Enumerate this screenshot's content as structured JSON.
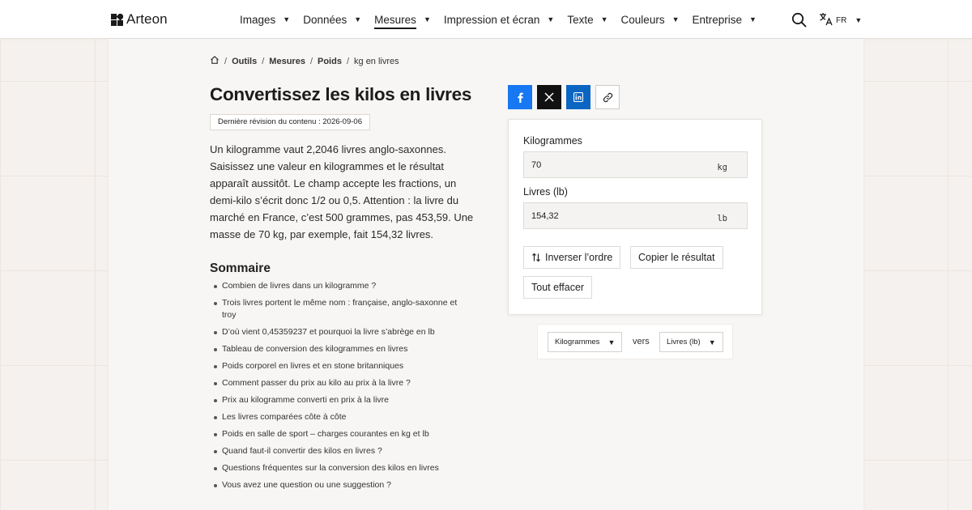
{
  "brand": {
    "name": "Arteon"
  },
  "nav": {
    "items": [
      {
        "label": "Images"
      },
      {
        "label": "Données"
      },
      {
        "label": "Mesures"
      },
      {
        "label": "Impression et écran"
      },
      {
        "label": "Texte"
      },
      {
        "label": "Couleurs"
      },
      {
        "label": "Entreprise"
      }
    ],
    "active": "Mesures",
    "language": "FR"
  },
  "breadcrumb": [
    "Outils",
    "Mesures",
    "Poids",
    "kg en livres"
  ],
  "page": {
    "title": "Convertissez les kilos en livres",
    "revision": "Dernière révision du contenu : 2026-09-06",
    "intro": "Un kilogramme vaut 2,2046 livres anglo-saxonnes. Saisissez une valeur en kilogrammes et le résultat apparaît aussitôt. Le champ accepte les fractions, un demi-kilo s’écrit donc 1/2 ou 0,5. Attention : la livre du marché en France, c’est 500 grammes, pas 453,59. Une masse de 70 kg, par exemple, fait 154,32 livres."
  },
  "toc": {
    "title": "Sommaire",
    "items": [
      "Combien de livres dans un kilogramme ?",
      "Trois livres portent le même nom : française, anglo-saxonne et troy",
      "D’où vient 0,45359237 et pourquoi la livre s’abrège en lb",
      "Tableau de conversion des kilogrammes en livres",
      "Poids corporel en livres et en stone britanniques",
      "Comment passer du prix au kilo au prix à la livre ?",
      "Prix au kilogramme converti en prix à la livre",
      "Les livres comparées côte à côte",
      "Poids en salle de sport – charges courantes en kg et lb",
      "Quand faut-il convertir des kilos en livres ?",
      "Questions fréquentes sur la conversion des kilos en livres",
      "Vous avez une question ou une suggestion ?"
    ]
  },
  "converter": {
    "from": {
      "label": "Kilogrammes",
      "value": "70",
      "unit": "kg"
    },
    "to": {
      "label": "Livres (lb)",
      "value": "154,32",
      "unit": "lb"
    },
    "swap_label": "Inverser l’ordre",
    "copy_label": "Copier le résultat",
    "clear_label": "Tout effacer"
  },
  "unit_selector": {
    "from": "Kilogrammes",
    "connector": "vers",
    "to": "Livres (lb)"
  },
  "colors": {
    "facebook": "#1877f2",
    "x": "#111111",
    "linkedin": "#0a66c2"
  }
}
